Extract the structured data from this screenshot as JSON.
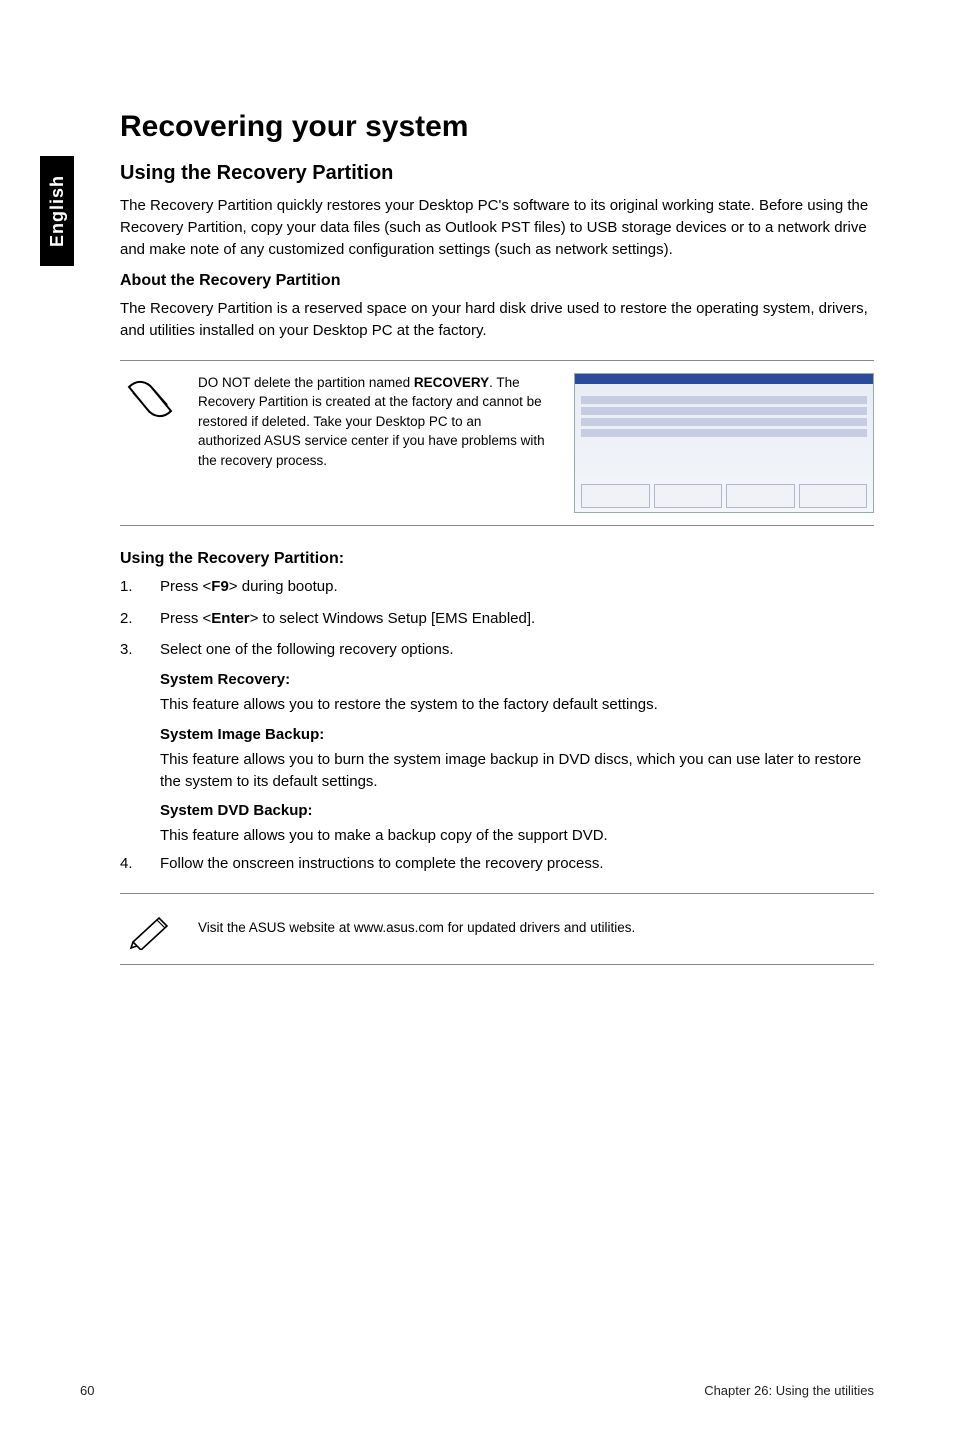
{
  "side_tab": "English",
  "h1": "Recovering your system",
  "h2": "Using the Recovery Partition",
  "intro": "The Recovery Partition quickly restores your Desktop PC's software to its original working state. Before using the Recovery Partition, copy your data files (such as Outlook PST files) to USB storage devices or to a network drive and make note of any customized configuration settings (such as network settings).",
  "about_head": "About the Recovery Partition",
  "about_body": "The Recovery Partition is a reserved space on your hard disk drive used to restore the operating system, drivers, and utilities installed on your Desktop PC at the factory.",
  "warn_pre": "DO NOT delete the partition named ",
  "warn_bold": "RECOVERY",
  "warn_post": ". The Recovery Partition is created at the factory and cannot be restored if deleted. Take your Desktop PC to an authorized ASUS service center if you have problems with the recovery process.",
  "using_head": "Using the Recovery Partition:",
  "steps": {
    "s1_pre": "Press <",
    "s1_key": "F9",
    "s1_post": "> during bootup.",
    "s2_pre": "Press <",
    "s2_key": "Enter",
    "s2_post": "> to select Windows Setup [EMS Enabled].",
    "s3": "Select one of the following recovery options.",
    "s4": "Follow the onscreen instructions to complete the recovery process."
  },
  "options": {
    "sys_rec_head": "System Recovery:",
    "sys_rec_body": "This feature allows you to restore the system to the factory default settings.",
    "img_bak_head": "System Image Backup:",
    "img_bak_body": "This feature allows you to burn the system image backup in DVD discs, which you can use later to restore the system to its default settings.",
    "dvd_bak_head": "System DVD Backup:",
    "dvd_bak_body": "This feature allows you to make a backup copy of the support DVD."
  },
  "tip": "Visit the ASUS website at www.asus.com for updated drivers and utilities.",
  "footer_page": "60",
  "footer_chapter": "Chapter 26: Using the utilities"
}
